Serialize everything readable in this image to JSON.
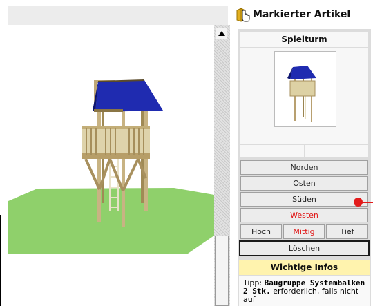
{
  "panel": {
    "title": "Markierter Artikel",
    "title_icon": "cursor-hand-icon",
    "product_name": "Spielturm"
  },
  "directions": [
    "Norden",
    "Osten",
    "Süden",
    "Westen"
  ],
  "active_direction": "Westen",
  "positions": [
    "Hoch",
    "Mittig",
    "Tief"
  ],
  "active_position": "Mittig",
  "delete_label": "Löschen",
  "info": {
    "heading": "Wichtige Infos",
    "tip_label": "Tipp:",
    "tip_bold": "Baugruppe Systembalken 2 Stk.",
    "tip_rest": "erforderlich, falls nicht auf"
  },
  "colors": {
    "active_text": "#e01010",
    "info_bg": "#fff3ae",
    "roof": "#1f2bb0",
    "lawn": "#8fd06b",
    "marker": "#e21b1b"
  }
}
